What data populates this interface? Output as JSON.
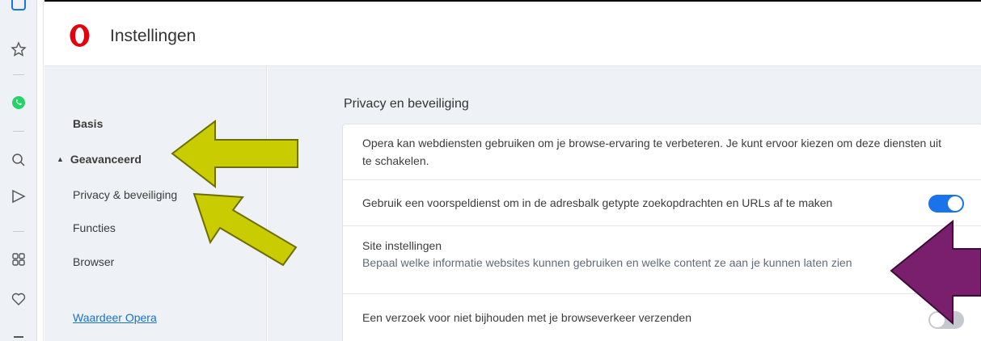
{
  "header": {
    "title": "Instellingen",
    "logo": "opera-logo"
  },
  "strip": {
    "icons": [
      "workspace-icon",
      "star-icon",
      "whatsapp-icon",
      "search-icon",
      "send-icon",
      "grid-icon",
      "heart-icon"
    ]
  },
  "nav": {
    "basis": "Basis",
    "geavanceerd": "Geavanceerd",
    "privacy": "Privacy & beveiliging",
    "functies": "Functies",
    "browser": "Browser",
    "rate": "Waardeer Opera"
  },
  "main": {
    "section_title": "Privacy en beveiliging",
    "rows": [
      {
        "text": "Opera kan webdiensten gebruiken om je browse-ervaring te verbeteren. Je kunt ervoor kiezen om deze diensten uit te schakelen."
      },
      {
        "text": "Gebruik een voorspeldienst om in de adresbalk getypte zoekopdrachten en URLs af te maken",
        "toggle": "on"
      },
      {
        "title": "Site instellingen",
        "subtitle": "Bepaal welke informatie websites kunnen gebruiken en welke content ze aan je kunnen laten zien"
      },
      {
        "text": "Een verzoek voor niet bijhouden met je browseverkeer verzenden",
        "toggle": "off"
      }
    ]
  },
  "colors": {
    "accent": "#1a73e8",
    "annotation_yellow": "#c8cc00",
    "annotation_purple": "#7a1f6e"
  }
}
